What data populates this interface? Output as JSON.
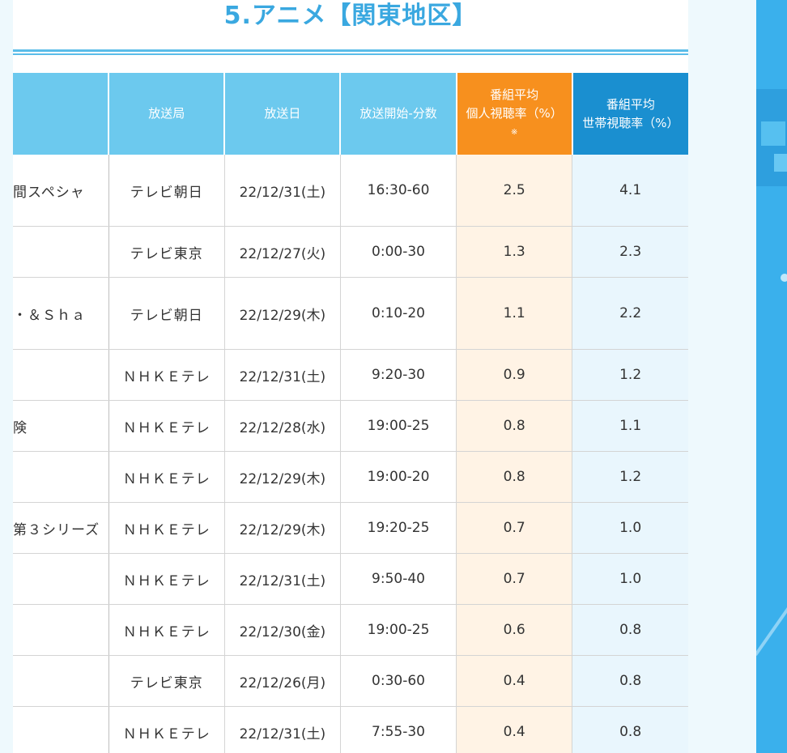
{
  "title": "5.アニメ【関東地区】",
  "table": {
    "headers": {
      "station": "放送局",
      "date": "放送日",
      "time": "放送開始-分数",
      "individual_line1": "番組平均",
      "individual_line2": "個人視聴率（%）",
      "individual_note": "※",
      "household_line1": "番組平均",
      "household_line2": "世帯視聴率（%）"
    },
    "rows": [
      {
        "program": "間スペシャ",
        "station": "テレビ朝日",
        "date": "22/12/31(土)",
        "time": "16:30-60",
        "individual": "2.5",
        "household": "4.1"
      },
      {
        "program": "",
        "station": "テレビ東京",
        "date": "22/12/27(火)",
        "time": "0:00-30",
        "individual": "1.3",
        "household": "2.3"
      },
      {
        "program": "・＆Ｓｈａ",
        "station": "テレビ朝日",
        "date": "22/12/29(木)",
        "time": "0:10-20",
        "individual": "1.1",
        "household": "2.2"
      },
      {
        "program": "",
        "station": "ＮＨＫＥテレ",
        "date": "22/12/31(土)",
        "time": "9:20-30",
        "individual": "0.9",
        "household": "1.2"
      },
      {
        "program": "険",
        "station": "ＮＨＫＥテレ",
        "date": "22/12/28(水)",
        "time": "19:00-25",
        "individual": "0.8",
        "household": "1.1"
      },
      {
        "program": "",
        "station": "ＮＨＫＥテレ",
        "date": "22/12/29(木)",
        "time": "19:00-20",
        "individual": "0.8",
        "household": "1.2"
      },
      {
        "program": "第３シリーズ",
        "station": "ＮＨＫＥテレ",
        "date": "22/12/29(木)",
        "time": "19:20-25",
        "individual": "0.7",
        "household": "1.0"
      },
      {
        "program": "",
        "station": "ＮＨＫＥテレ",
        "date": "22/12/31(土)",
        "time": "9:50-40",
        "individual": "0.7",
        "household": "1.0"
      },
      {
        "program": "",
        "station": "ＮＨＫＥテレ",
        "date": "22/12/30(金)",
        "time": "19:00-25",
        "individual": "0.6",
        "household": "0.8"
      },
      {
        "program": "",
        "station": "テレビ東京",
        "date": "22/12/26(月)",
        "time": "0:30-60",
        "individual": "0.4",
        "household": "0.8"
      },
      {
        "program": "",
        "station": "ＮＨＫＥテレ",
        "date": "22/12/31(土)",
        "time": "7:55-30",
        "individual": "0.4",
        "household": "0.8"
      }
    ]
  },
  "colors": {
    "title": "#3aa8e0",
    "header_light_blue": "#6cc9ee",
    "header_orange": "#f7901e",
    "header_dark_blue": "#1a8fd0",
    "individual_cell_bg": "#fff3e5",
    "household_cell_bg": "#e9f6fd",
    "sidebar": "#3ab0ec"
  }
}
